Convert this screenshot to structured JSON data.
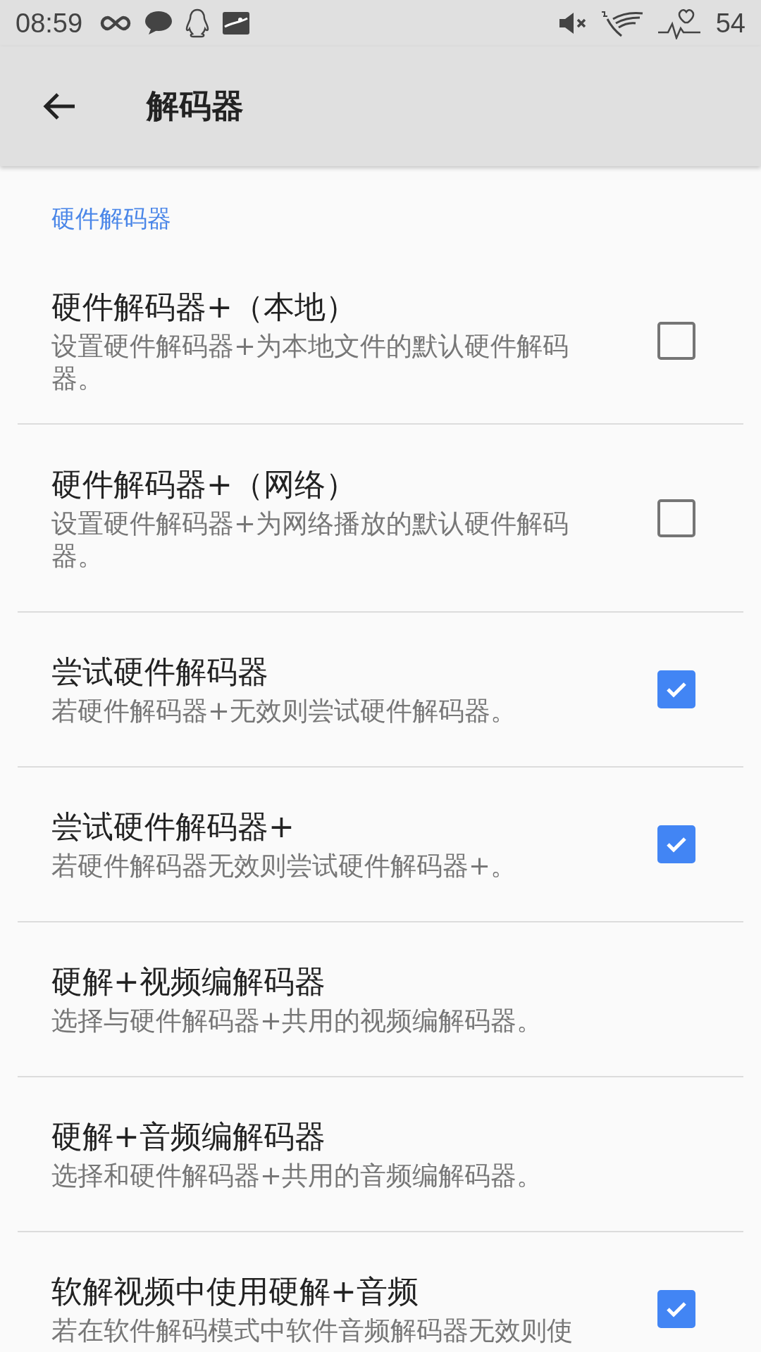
{
  "status_bar": {
    "time": "08:59",
    "battery": "54"
  },
  "app_bar": {
    "title": "解码器"
  },
  "section": {
    "title": "硬件解码器"
  },
  "items": [
    {
      "kind": "checkbox",
      "title": "硬件解码器+（本地）",
      "summary": "设置硬件解码器+为本地文件的默认硬件解码器。",
      "checked": false
    },
    {
      "kind": "checkbox",
      "title": "硬件解码器+（网络）",
      "summary": "设置硬件解码器+为网络播放的默认硬件解码器。",
      "checked": false
    },
    {
      "kind": "checkbox",
      "title": "尝试硬件解码器",
      "summary": "若硬件解码器+无效则尝试硬件解码器。",
      "checked": true
    },
    {
      "kind": "checkbox",
      "title": "尝试硬件解码器+",
      "summary": "若硬件解码器无效则尝试硬件解码器+。",
      "checked": true
    },
    {
      "kind": "plain",
      "title": "硬解+视频编解码器",
      "summary": "选择与硬件解码器+共用的视频编解码器。"
    },
    {
      "kind": "plain",
      "title": "硬解+音频编解码器",
      "summary": "选择和硬件解码器+共用的音频编解码器。"
    },
    {
      "kind": "checkbox",
      "title": "软解视频中使用硬解+音频",
      "summary": "若在软件解码模式中软件音频解码器无效则使",
      "checked": true
    }
  ]
}
